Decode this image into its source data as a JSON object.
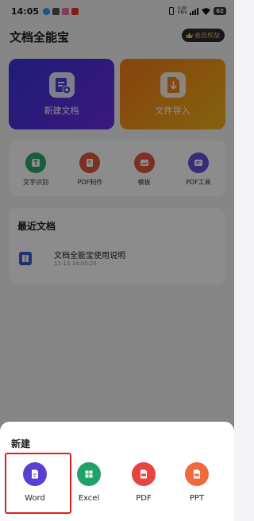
{
  "status_bar": {
    "time": "14:05",
    "net_speed": "0.00",
    "net_unit": "KB/s",
    "battery": "62"
  },
  "header": {
    "title": "文档全能宝",
    "vip_label": "会员权益"
  },
  "cards": {
    "new_doc": "新建文档",
    "import_file": "文件导入"
  },
  "tools": [
    {
      "label": "文字识别",
      "icon": "text-recognition-icon",
      "color": "#2fa66a"
    },
    {
      "label": "PDF制作",
      "icon": "pdf-make-icon",
      "color": "#e2573e"
    },
    {
      "label": "模板",
      "icon": "template-icon",
      "color": "#e2573e"
    },
    {
      "label": "PDF工具",
      "icon": "pdf-tools-icon",
      "color": "#6a4fd8"
    }
  ],
  "recent": {
    "title": "最近文档",
    "items": [
      {
        "name": "文档全能宝使用说明",
        "time": "11-13 14:05:25"
      }
    ]
  },
  "sheet": {
    "title": "新建",
    "options": [
      {
        "label": "Word",
        "icon": "word-doc-icon",
        "color": "#5a3fd1"
      },
      {
        "label": "Excel",
        "icon": "excel-sheet-icon",
        "color": "#21a06a"
      },
      {
        "label": "PDF",
        "icon": "pdf-file-icon",
        "color": "#e8443e"
      },
      {
        "label": "PPT",
        "icon": "ppt-file-icon",
        "color": "#ef6a3c"
      }
    ]
  },
  "colors": {
    "new_card_gradient": [
      "#3a34d8",
      "#6a2ee6"
    ],
    "import_card_gradient": [
      "#f77c1b",
      "#f2b21a"
    ],
    "highlight": "#e02020"
  }
}
